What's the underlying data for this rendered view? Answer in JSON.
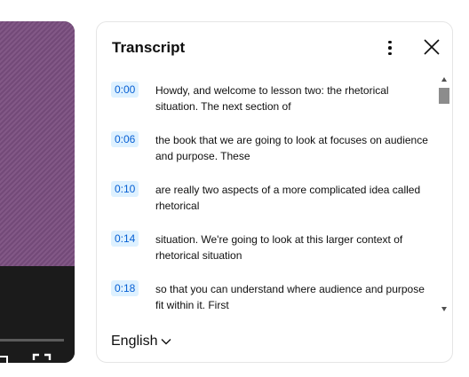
{
  "transcript": {
    "title": "Transcript",
    "menu_icon": "more-vert-icon",
    "close_icon": "close-icon",
    "segments": [
      {
        "time": "0:00",
        "text": "Howdy, and welcome to lesson two: the rhetorical situation. The next section of"
      },
      {
        "time": "0:06",
        "text": "the book that we are going to look at focuses on audience and purpose. These"
      },
      {
        "time": "0:10",
        "text": "are really two aspects of a more complicated idea called rhetorical"
      },
      {
        "time": "0:14",
        "text": "situation. We're going to look at this larger context of rhetorical situation"
      },
      {
        "time": "0:18",
        "text": "so that you can understand where audience and purpose fit within it. First"
      }
    ],
    "language": "English"
  },
  "player": {
    "icons": [
      "miniplayer-icon",
      "fullscreen-icon"
    ]
  },
  "colors": {
    "timestamp_bg": "#def1ff",
    "timestamp_text": "#065fd4",
    "video_bg": "#7a4e7f"
  }
}
